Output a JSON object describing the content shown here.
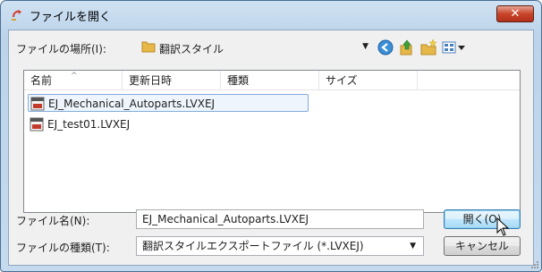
{
  "window": {
    "title": "ファイルを開く",
    "close_label": "✕"
  },
  "toolbar": {
    "lookin_label": "ファイルの場所(I):",
    "lookin_value": "翻訳スタイル"
  },
  "columns": [
    "名前",
    "更新日時",
    "種類",
    "サイズ"
  ],
  "files": [
    {
      "name": "EJ_Mechanical_Autoparts.LVXEJ",
      "selected": true
    },
    {
      "name": "EJ_test01.LVXEJ",
      "selected": false
    }
  ],
  "bottom": {
    "filename_label": "ファイル名(N):",
    "filename_value": "EJ_Mechanical_Autoparts.LVXEJ",
    "filetype_label": "ファイルの種類(T):",
    "filetype_value": "翻訳スタイルエクスポートファイル (*.LVXEJ)",
    "open_label": "開く(O)",
    "cancel_label": "キャンセル"
  },
  "colors": {
    "accent": "#3c7fb1",
    "close": "#c7452a"
  },
  "icons": [
    "title-open-icon",
    "folder-icon",
    "back-icon",
    "up-folder-icon",
    "new-folder-icon",
    "view-menu-icon",
    "file-icon",
    "mouse-cursor-icon"
  ]
}
